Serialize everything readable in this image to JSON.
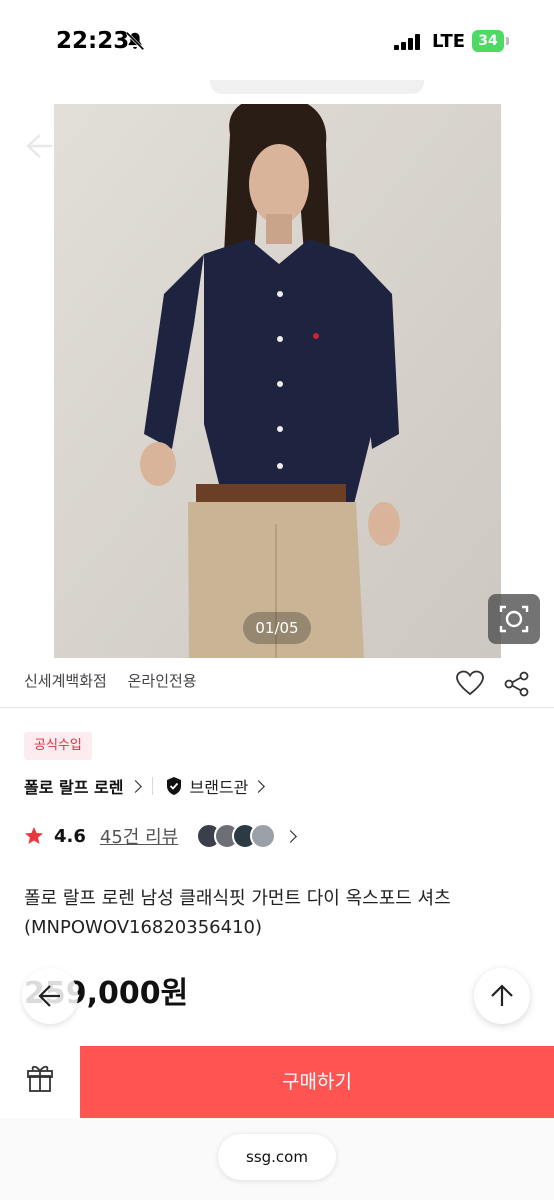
{
  "status_bar": {
    "time": "22:23",
    "network": "LTE",
    "battery": "34"
  },
  "gallery": {
    "counter": "01/05"
  },
  "seller": {
    "store": "신세계백화점",
    "tag": "온라인전용"
  },
  "badge": {
    "official": "공식수입"
  },
  "brand": {
    "name": "폴로 랄프 로렌",
    "hall_label": "브랜드관"
  },
  "rating": {
    "score": "4.6",
    "reviews_label": "45건 리뷰"
  },
  "product": {
    "title": "폴로 랄프 로렌 남성 클래식핏 가먼트 다이 옥스포드 셔츠(MNPOWOV16820356410)"
  },
  "price": {
    "main": "259,000원"
  },
  "actions": {
    "buy_label": "구매하기"
  },
  "browser": {
    "url": "ssg.com"
  },
  "colors": {
    "accent": "#ff5452",
    "badge_bg": "#fdecef",
    "badge_text": "#e0313f",
    "star": "#e8383d",
    "battery": "#4cd964"
  },
  "icons": [
    "bell-slash-icon",
    "signal-icon",
    "battery-icon",
    "back-arrow-icon",
    "lens-icon",
    "heart-icon",
    "share-icon",
    "shield-check-icon",
    "star-icon",
    "chevron-right-icon",
    "up-arrow-icon",
    "gift-icon"
  ]
}
